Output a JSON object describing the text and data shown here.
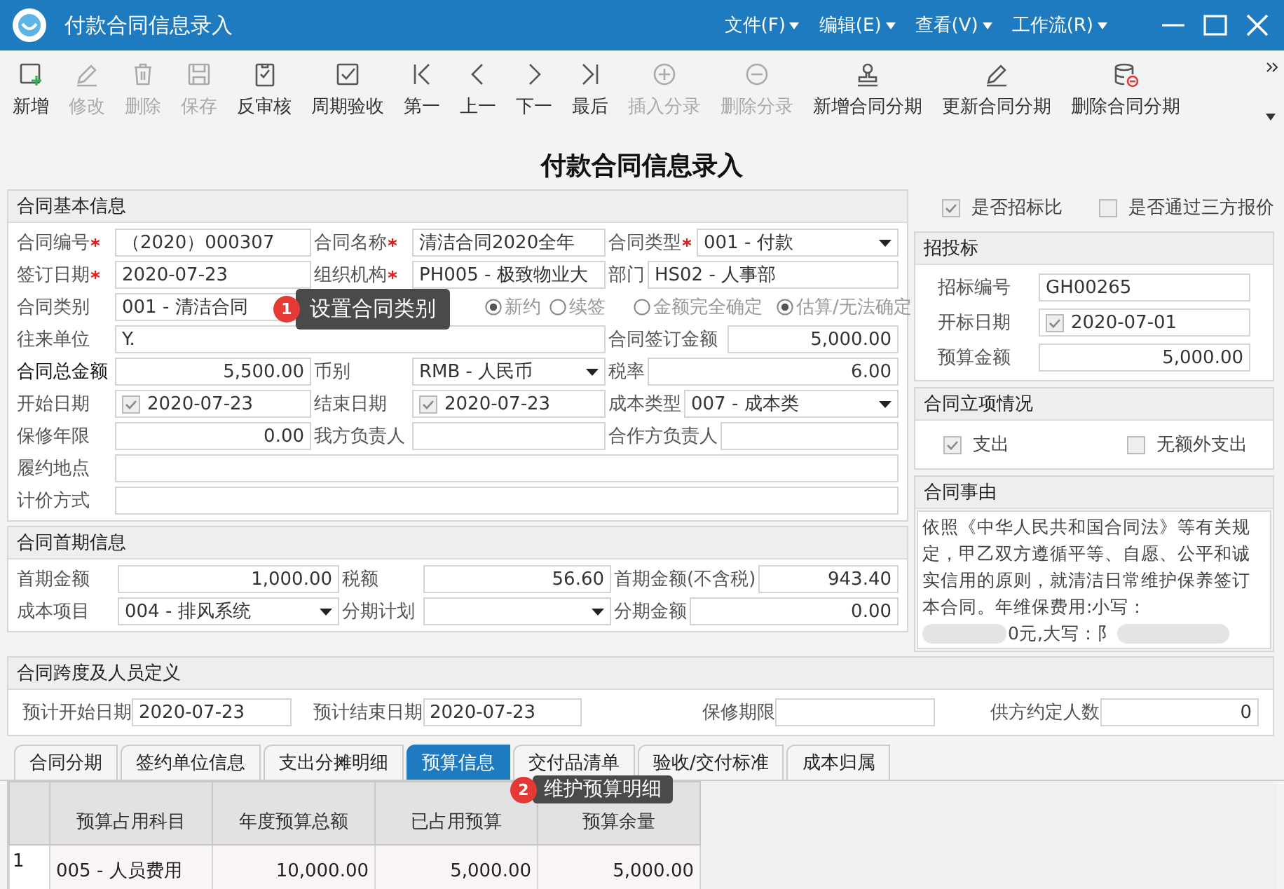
{
  "window": {
    "title": "付款合同信息录入",
    "menus": [
      "文件(F)",
      "编辑(E)",
      "查看(V)",
      "工作流(R)"
    ]
  },
  "toolbar": [
    {
      "label": "新增",
      "kind": "new",
      "disabled": false
    },
    {
      "label": "修改",
      "kind": "edit",
      "disabled": true
    },
    {
      "label": "删除",
      "kind": "trash",
      "disabled": true
    },
    {
      "label": "保存",
      "kind": "save",
      "disabled": true
    },
    {
      "label": "反审核",
      "kind": "clip",
      "disabled": false
    },
    {
      "label": "周期验收",
      "kind": "check",
      "disabled": false
    },
    {
      "label": "第一",
      "kind": "first",
      "disabled": false
    },
    {
      "label": "上一",
      "kind": "prev",
      "disabled": false
    },
    {
      "label": "下一",
      "kind": "next",
      "disabled": false
    },
    {
      "label": "最后",
      "kind": "last",
      "disabled": false
    },
    {
      "label": "插入分录",
      "kind": "plus",
      "disabled": true
    },
    {
      "label": "删除分录",
      "kind": "minus",
      "disabled": true
    },
    {
      "label": "新增合同分期",
      "kind": "stamp",
      "disabled": false
    },
    {
      "label": "更新合同分期",
      "kind": "edit",
      "disabled": false
    },
    {
      "label": "删除合同分期",
      "kind": "db",
      "disabled": false
    }
  ],
  "page_title": "付款合同信息录入",
  "basic": {
    "title": "合同基本信息",
    "rows": [
      {
        "kind": "triple",
        "fields": [
          {
            "label": "合同编号",
            "required": true,
            "value": "（2020）000307",
            "kind": "text"
          },
          {
            "label": "合同名称",
            "required": true,
            "value": "清洁合同2020全年",
            "kind": "text"
          },
          {
            "label": "合同类型",
            "required": true,
            "value": "001 - 付款",
            "kind": "select"
          }
        ]
      },
      {
        "kind": "triple",
        "fields": [
          {
            "label": "签订日期",
            "required": true,
            "value": "2020-07-23",
            "kind": "text"
          },
          {
            "label": "组织机构",
            "required": true,
            "value": "PH005 - 极致物业大",
            "kind": "text"
          },
          {
            "label": "部门",
            "required": false,
            "value": "HS02 - 人事部",
            "kind": "text"
          }
        ]
      },
      {
        "kind": "radios",
        "fields": [
          {
            "label": "合同类别",
            "required": false,
            "value": "001 - 清洁合同",
            "kind": "select"
          }
        ],
        "options": [
          {
            "label": "新约",
            "selected": true
          },
          {
            "label": "续签",
            "selected": false
          },
          {
            "label": "金额完全确定",
            "selected": false
          },
          {
            "label": "估算/无法确定",
            "selected": true
          }
        ]
      },
      {
        "kind": "wide",
        "fields": [
          {
            "label": "往来单位",
            "required": false,
            "value": "Y.",
            "kind": "text"
          },
          {
            "label": "合同签订金额",
            "required": false,
            "value": "5,000.00",
            "kind": "number"
          }
        ]
      },
      {
        "kind": "triple",
        "fields": [
          {
            "label": "合同总金额",
            "required": false,
            "strong": true,
            "value": "5,500.00",
            "kind": "number"
          },
          {
            "label": "币别",
            "required": false,
            "value": "RMB - 人民币",
            "kind": "select"
          },
          {
            "label": "税率",
            "required": false,
            "value": "6.00",
            "kind": "number"
          }
        ]
      },
      {
        "kind": "triple",
        "fields": [
          {
            "label": "开始日期",
            "required": false,
            "value": "2020-07-23",
            "kind": "date",
            "checked": true
          },
          {
            "label": "结束日期",
            "required": false,
            "value": "2020-07-23",
            "kind": "date",
            "checked": true
          },
          {
            "label": "成本类型",
            "required": false,
            "value": "007 - 成本类",
            "kind": "select"
          }
        ]
      },
      {
        "kind": "triple",
        "fields": [
          {
            "label": "保修年限",
            "required": false,
            "value": "0.00",
            "kind": "number"
          },
          {
            "label": "我方负责人",
            "required": false,
            "kind": "text"
          },
          {
            "label": "合作方负责人",
            "required": false,
            "kind": "text"
          }
        ]
      },
      {
        "kind": "full",
        "fields": [
          {
            "label": "履约地点",
            "required": false,
            "kind": "text"
          }
        ]
      },
      {
        "kind": "full",
        "fields": [
          {
            "label": "计价方式",
            "required": false,
            "kind": "text"
          }
        ]
      }
    ]
  },
  "flags": [
    {
      "label": "是否招标比",
      "checked": true
    },
    {
      "label": "是否通过三方报价",
      "checked": false
    }
  ],
  "bidding": {
    "title": "招投标",
    "fields": [
      {
        "label": "招标编号",
        "value": "GH00265",
        "kind": "text"
      },
      {
        "label": "开标日期",
        "value": "2020-07-01",
        "kind": "date",
        "checked": true
      },
      {
        "label": "预算金额",
        "value": "5,000.00",
        "kind": "number"
      }
    ]
  },
  "approval": {
    "title": "合同立项情况",
    "options": [
      {
        "label": "支出",
        "checked": true
      },
      {
        "label": "无额外支出",
        "checked": false
      }
    ]
  },
  "reason": {
    "title": "合同事由",
    "text": "依照《中华人民共和国合同法》等有关规定，甲乙双方遵循平等、自愿、公平和诚实信用的原则，就清洁日常维护保养签订本合同。年维保费用:小写：",
    "tail": "0元,大写：阝"
  },
  "first_period": {
    "title": "合同首期信息",
    "rows": [
      [
        {
          "label": "首期金额",
          "value": "1,000.00",
          "kind": "number"
        },
        {
          "label": "税额",
          "value": "56.60",
          "kind": "number"
        },
        {
          "label": "首期金额(不含税)",
          "value": "943.40",
          "kind": "number"
        }
      ],
      [
        {
          "label": "成本项目",
          "value": "004 - 排风系统",
          "kind": "select"
        },
        {
          "label": "分期计划",
          "kind": "select"
        },
        {
          "label": "分期金额",
          "value": "0.00",
          "kind": "number"
        }
      ]
    ]
  },
  "span": {
    "title": "合同跨度及人员定义",
    "fields": [
      {
        "label": "预计开始日期",
        "value": "2020-07-23",
        "kind": "text"
      },
      {
        "label": "预计结束日期",
        "value": "2020-07-23",
        "kind": "text"
      },
      {
        "label": "保修期限",
        "kind": "text"
      },
      {
        "label": "供方约定人数",
        "value": "0",
        "kind": "number"
      }
    ]
  },
  "tabs": [
    {
      "label": "合同分期",
      "selected": false
    },
    {
      "label": "签约单位信息",
      "selected": false
    },
    {
      "label": "支出分摊明细",
      "selected": false
    },
    {
      "label": "预算信息",
      "selected": true
    },
    {
      "label": "交付品清单",
      "selected": false
    },
    {
      "label": "验收/交付标准",
      "selected": false
    },
    {
      "label": "成本归属",
      "selected": false
    }
  ],
  "table": {
    "columns": [
      "预算占用科目",
      "年度预算总额",
      "已占用预算",
      "预算余量"
    ],
    "rows": [
      {
        "number": "1",
        "cells": [
          "005 - 人员费用",
          "10,000.00",
          "5,000.00",
          "5,000.00"
        ]
      }
    ]
  },
  "hints": [
    {
      "number": "1",
      "text": "设置合同类别"
    },
    {
      "number": "2",
      "text": "维护预算明细"
    }
  ]
}
